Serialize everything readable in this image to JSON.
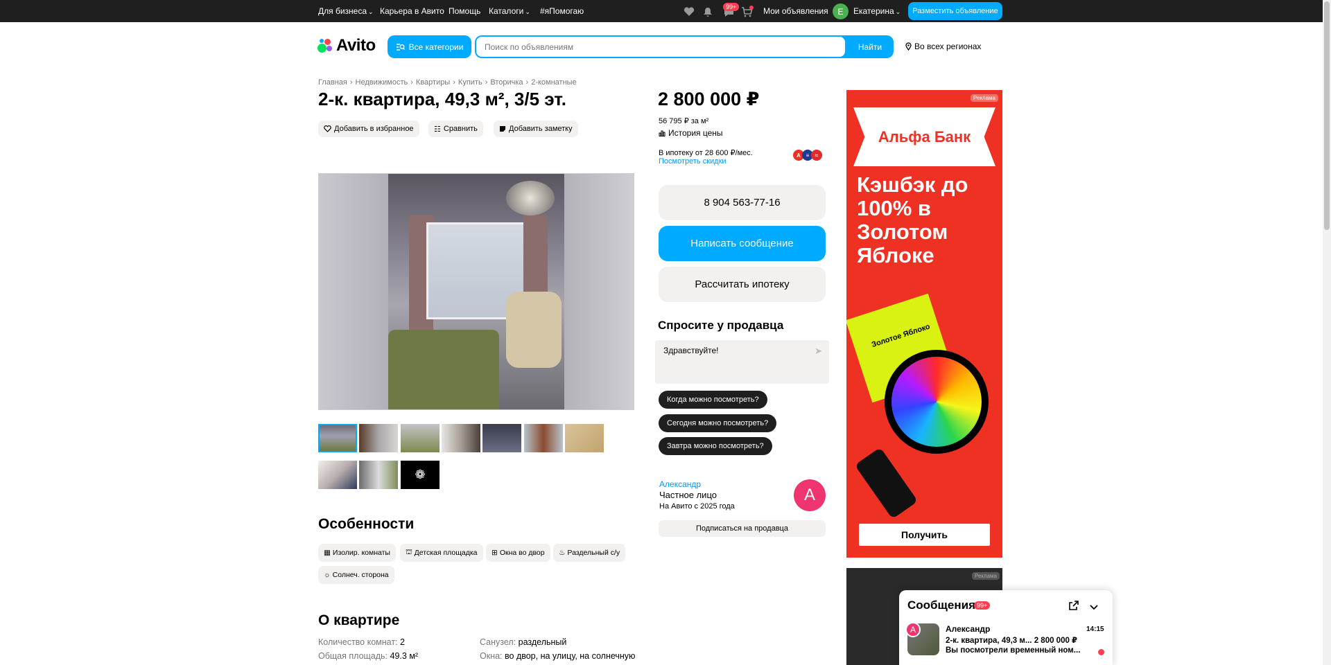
{
  "topbar": {
    "business": "Для бизнеса",
    "career": "Карьера в Авито",
    "help": "Помощь",
    "catalogs": "Каталоги",
    "helping": "#яПомогаю",
    "messages_badge": "99+",
    "my_ads": "Мои объявления",
    "user_initial": "E",
    "user_name": "Екатерина",
    "post_ad": "Разместить объявление"
  },
  "header": {
    "logo": "Avito",
    "all_categories": "Все категории",
    "search_placeholder": "Поиск по объявлениям",
    "search_button": "Найти",
    "region": "Во всех регионах"
  },
  "breadcrumbs": [
    "Главная",
    "Недвижимость",
    "Квартиры",
    "Купить",
    "Вторичка",
    "2-комнатные"
  ],
  "listing": {
    "title": "2-к. квартира, 49,3 м², 3/5 эт.",
    "add_favorite": "Добавить в избранное",
    "compare": "Сравнить",
    "add_note": "Добавить заметку"
  },
  "features": {
    "heading": "Особенности",
    "items": [
      "Изолир. комнаты",
      "Детская площадка",
      "Окна во двор",
      "Раздельный с/у",
      "Солнеч. сторона"
    ]
  },
  "about": {
    "heading": "О квартире",
    "rooms_label": "Количество комнат:",
    "rooms_value": "2",
    "area_label": "Общая площадь:",
    "area_value": "49.3 м²",
    "bath_label": "Санузел:",
    "bath_value": "раздельный",
    "windows_label": "Окна:",
    "windows_value": "во двор, на улицу, на солнечную"
  },
  "price": {
    "value": "2 800 000 ₽",
    "per_meter": "56 795 ₽ за м²",
    "history": "История цены",
    "mortgage": "В ипотеку от 28 600 ₽/мес.",
    "discounts": "Посмотреть скидки"
  },
  "contact": {
    "phone": "8 904 563-77-16",
    "write": "Написать сообщение",
    "mortgage_calc": "Рассчитать ипотеку",
    "ask_title": "Спросите у продавца",
    "message_value": "Здравствуйте!",
    "quick": [
      "Когда можно посмотреть?",
      "Сегодня можно посмотреть?",
      "Завтра можно посмотреть?"
    ]
  },
  "seller": {
    "name": "Александр",
    "type": "Частное лицо",
    "since": "На Авито с 2025 года",
    "initial": "А",
    "subscribe": "Подписаться на продавца"
  },
  "ad": {
    "label": "Реклама",
    "bank": "Альфа Банк",
    "text": "Кэшбэк до 100% в Золотом Яблоке",
    "bag_label": "Золотое Яблоко",
    "button": "Получить",
    "label2": "Реклама"
  },
  "messenger": {
    "title": "Сообщения",
    "badge": "99+",
    "avatar_initial": "А",
    "name": "Александр",
    "subject": "2-к. квартира, 49,3 м...",
    "price": "2 800 000 ₽",
    "last": "Вы посмотрели временный ном...",
    "time": "14:15"
  },
  "colors": {
    "accent": "#00aaff",
    "dark": "#1f1f1f",
    "alert": "#ff4053",
    "ad_red": "#ef3124"
  }
}
